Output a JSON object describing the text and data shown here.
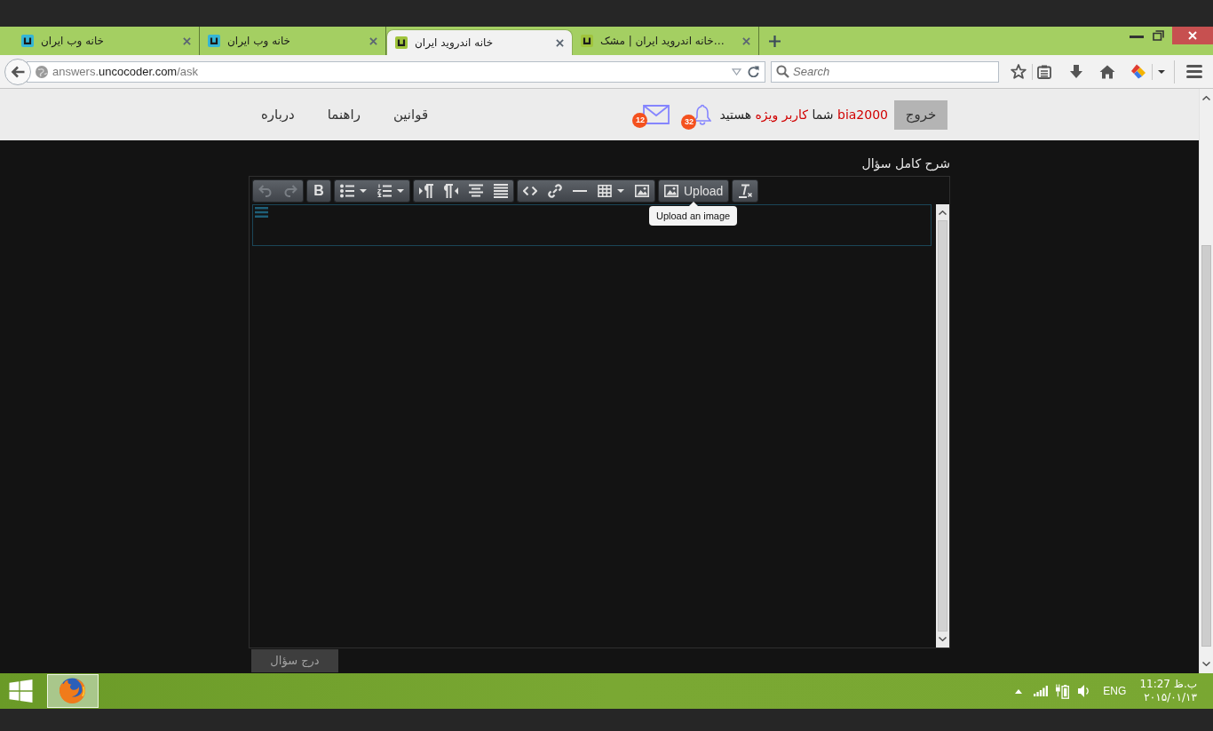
{
  "browser": {
    "tabs": [
      {
        "title": "خانه اندروید ایران | مشک…",
        "selected": false,
        "color": "#a0c43c"
      },
      {
        "title": "خانه اندروید ایران",
        "selected": true,
        "color": "#a0c43c"
      },
      {
        "title": "خانه وب ایران",
        "selected": false,
        "color": "#35b5d5"
      },
      {
        "title": "خانه وب ایران",
        "selected": false,
        "color": "#35b5d5"
      }
    ],
    "address": {
      "subdomain": "answers.",
      "domain": "uncocoder.com",
      "path": "/ask"
    },
    "search": {
      "placeholder": "Search"
    }
  },
  "header": {
    "logout": "خروج",
    "greeting": [
      {
        "text": "bia2000",
        "highlight": true
      },
      {
        "text": "شما",
        "highlight": false
      },
      {
        "text": "کاربر ویژه",
        "highlight": true
      },
      {
        "text": "هستید",
        "highlight": false
      }
    ],
    "notifications": "32",
    "messages": "12",
    "nav": [
      "قوانین",
      "راهنما",
      "درباره"
    ]
  },
  "editor": {
    "label": "شرح کامل سؤال",
    "toolbar": [
      {
        "buttons": [
          {
            "kind": "unformat",
            "disabled": false,
            "dropdown": false
          }
        ]
      },
      {
        "buttons": [
          {
            "kind": "upload",
            "label": "Upload",
            "disabled": false,
            "dropdown": false
          }
        ]
      },
      {
        "buttons": [
          {
            "kind": "image",
            "disabled": false,
            "dropdown": false
          },
          {
            "kind": "table",
            "disabled": false,
            "dropdown": true
          },
          {
            "kind": "rule",
            "disabled": false,
            "dropdown": false
          },
          {
            "kind": "link",
            "disabled": false,
            "dropdown": false
          },
          {
            "kind": "code",
            "disabled": false,
            "dropdown": false
          }
        ]
      },
      {
        "buttons": [
          {
            "kind": "justify",
            "disabled": false,
            "dropdown": false
          },
          {
            "kind": "center",
            "disabled": false,
            "dropdown": false
          },
          {
            "kind": "rtl",
            "disabled": false,
            "dropdown": false
          },
          {
            "kind": "ltr",
            "disabled": false,
            "dropdown": false
          }
        ]
      },
      {
        "buttons": [
          {
            "kind": "numbers",
            "disabled": false,
            "dropdown": true
          },
          {
            "kind": "bullets",
            "disabled": false,
            "dropdown": true
          }
        ]
      },
      {
        "buttons": [
          {
            "kind": "bold",
            "label": "B",
            "disabled": false,
            "dropdown": false
          }
        ]
      },
      {
        "buttons": [
          {
            "kind": "redo",
            "disabled": true,
            "dropdown": false
          },
          {
            "kind": "undo",
            "disabled": true,
            "dropdown": false
          }
        ]
      }
    ],
    "tooltip": "Upload an image",
    "submit": "درج سؤال"
  },
  "taskbar": {
    "apps": [
      {
        "active": true
      }
    ],
    "language": "ENG",
    "time": "11:27 ب.ظ",
    "date": "۲۰۱۵/۰۱/۱۳"
  }
}
